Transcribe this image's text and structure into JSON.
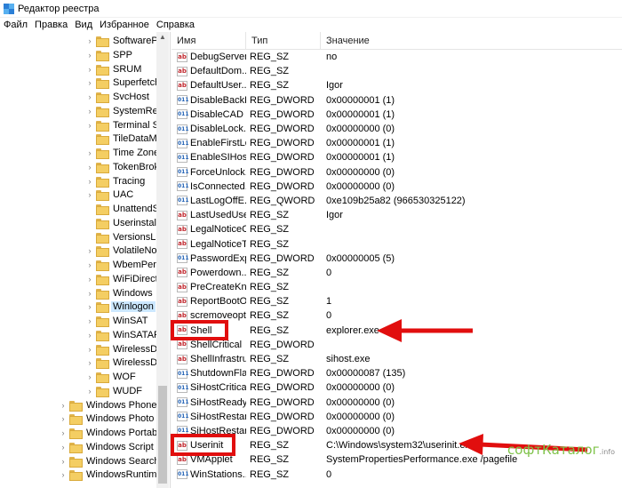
{
  "window": {
    "title": "Редактор реестра"
  },
  "menu": [
    "Файл",
    "Правка",
    "Вид",
    "Избранное",
    "Справка"
  ],
  "tree": {
    "items": [
      {
        "label": "SoftwarePro",
        "expander": true,
        "indent": 1
      },
      {
        "label": "SPP",
        "expander": true,
        "indent": 1
      },
      {
        "label": "SRUM",
        "expander": true,
        "indent": 1
      },
      {
        "label": "Superfetch",
        "expander": true,
        "indent": 1
      },
      {
        "label": "SvcHost",
        "expander": true,
        "indent": 1
      },
      {
        "label": "SystemRest",
        "expander": true,
        "indent": 1
      },
      {
        "label": "Terminal Se",
        "expander": true,
        "indent": 1
      },
      {
        "label": "TileDataMo",
        "expander": false,
        "indent": 1
      },
      {
        "label": "Time Zones",
        "expander": true,
        "indent": 1
      },
      {
        "label": "TokenBroke",
        "expander": true,
        "indent": 1
      },
      {
        "label": "Tracing",
        "expander": true,
        "indent": 1
      },
      {
        "label": "UAC",
        "expander": true,
        "indent": 1
      },
      {
        "label": "UnattendSe",
        "expander": false,
        "indent": 1
      },
      {
        "label": "Userinstall",
        "expander": false,
        "indent": 1
      },
      {
        "label": "VersionsList",
        "expander": false,
        "indent": 1
      },
      {
        "label": "VolatileNoti",
        "expander": true,
        "indent": 1
      },
      {
        "label": "WbemPerf",
        "expander": true,
        "indent": 1
      },
      {
        "label": "WiFiDirectA",
        "expander": true,
        "indent": 1
      },
      {
        "label": "Windows",
        "expander": true,
        "indent": 1
      },
      {
        "label": "Winlogon",
        "expander": true,
        "indent": 1,
        "selected": true
      },
      {
        "label": "WinSAT",
        "expander": true,
        "indent": 1
      },
      {
        "label": "WinSATAPI",
        "expander": true,
        "indent": 1
      },
      {
        "label": "WirelessDis",
        "expander": true,
        "indent": 1
      },
      {
        "label": "WirelessDoc",
        "expander": true,
        "indent": 1
      },
      {
        "label": "WOF",
        "expander": true,
        "indent": 1
      },
      {
        "label": "WUDF",
        "expander": true,
        "indent": 1
      },
      {
        "label": "Windows Phone",
        "expander": true,
        "indent": 0
      },
      {
        "label": "Windows Photo Vi",
        "expander": true,
        "indent": 0
      },
      {
        "label": "Windows Portable",
        "expander": true,
        "indent": 0
      },
      {
        "label": "Windows Script Ho",
        "expander": true,
        "indent": 0
      },
      {
        "label": "Windows Search",
        "expander": true,
        "indent": 0
      },
      {
        "label": "WindowsRuntime",
        "expander": true,
        "indent": 0
      }
    ]
  },
  "list": {
    "columns": {
      "name": "Имя",
      "type": "Тип",
      "value": "Значение"
    },
    "rows": [
      {
        "icon": "sz",
        "name": "DebugServer...",
        "type": "REG_SZ",
        "value": "no"
      },
      {
        "icon": "sz",
        "name": "DefaultDom...",
        "type": "REG_SZ",
        "value": ""
      },
      {
        "icon": "sz",
        "name": "DefaultUser...",
        "type": "REG_SZ",
        "value": "Igor"
      },
      {
        "icon": "dw",
        "name": "DisableBackB...",
        "type": "REG_DWORD",
        "value": "0x00000001 (1)"
      },
      {
        "icon": "dw",
        "name": "DisableCAD",
        "type": "REG_DWORD",
        "value": "0x00000001 (1)"
      },
      {
        "icon": "dw",
        "name": "DisableLock...",
        "type": "REG_DWORD",
        "value": "0x00000000 (0)"
      },
      {
        "icon": "dw",
        "name": "EnableFirstLo...",
        "type": "REG_DWORD",
        "value": "0x00000001 (1)"
      },
      {
        "icon": "dw",
        "name": "EnableSIHos...",
        "type": "REG_DWORD",
        "value": "0x00000001 (1)"
      },
      {
        "icon": "dw",
        "name": "ForceUnlock...",
        "type": "REG_DWORD",
        "value": "0x00000000 (0)"
      },
      {
        "icon": "dw",
        "name": "IsConnected...",
        "type": "REG_DWORD",
        "value": "0x00000000 (0)"
      },
      {
        "icon": "dw",
        "name": "LastLogOffE...",
        "type": "REG_QWORD",
        "value": "0xe109b25a82 (966530325122)"
      },
      {
        "icon": "sz",
        "name": "LastUsedUse...",
        "type": "REG_SZ",
        "value": "Igor"
      },
      {
        "icon": "sz",
        "name": "LegalNoticeC...",
        "type": "REG_SZ",
        "value": ""
      },
      {
        "icon": "sz",
        "name": "LegalNoticeT...",
        "type": "REG_SZ",
        "value": ""
      },
      {
        "icon": "dw",
        "name": "PasswordExp...",
        "type": "REG_DWORD",
        "value": "0x00000005 (5)"
      },
      {
        "icon": "sz",
        "name": "Powerdown...",
        "type": "REG_SZ",
        "value": "0"
      },
      {
        "icon": "sz",
        "name": "PreCreateKn...",
        "type": "REG_SZ",
        "value": ""
      },
      {
        "icon": "sz",
        "name": "ReportBootOk",
        "type": "REG_SZ",
        "value": "1"
      },
      {
        "icon": "sz",
        "name": "scremoveopt...",
        "type": "REG_SZ",
        "value": "0"
      },
      {
        "icon": "sz",
        "name": "Shell",
        "type": "REG_SZ",
        "value": "explorer.exe"
      },
      {
        "icon": "sz",
        "name": "ShellCritical",
        "type": "REG_DWORD",
        "value": ""
      },
      {
        "icon": "sz",
        "name": "ShellInfrastru...",
        "type": "REG_SZ",
        "value": "sihost.exe"
      },
      {
        "icon": "dw",
        "name": "ShutdownFla...",
        "type": "REG_DWORD",
        "value": "0x00000087 (135)"
      },
      {
        "icon": "dw",
        "name": "SiHostCritical",
        "type": "REG_DWORD",
        "value": "0x00000000 (0)"
      },
      {
        "icon": "dw",
        "name": "SiHostReady...",
        "type": "REG_DWORD",
        "value": "0x00000000 (0)"
      },
      {
        "icon": "dw",
        "name": "SiHostRestar...",
        "type": "REG_DWORD",
        "value": "0x00000000 (0)"
      },
      {
        "icon": "dw",
        "name": "SiHostRestar...",
        "type": "REG_DWORD",
        "value": "0x00000000 (0)"
      },
      {
        "icon": "sz",
        "name": "Userinit",
        "type": "REG_SZ",
        "value": "C:\\Windows\\system32\\userinit.exe,"
      },
      {
        "icon": "sz",
        "name": "VMApplet",
        "type": "REG_SZ",
        "value": "SystemPropertiesPerformance.exe /pagefile"
      },
      {
        "icon": "dw",
        "name": "WinStations...",
        "type": "REG_SZ",
        "value": "0"
      }
    ]
  },
  "watermark": {
    "text": "софтКаталог",
    "suffix": ".info"
  },
  "colors": {
    "highlight": "#e10e0e",
    "selection": "#cce8ff"
  }
}
